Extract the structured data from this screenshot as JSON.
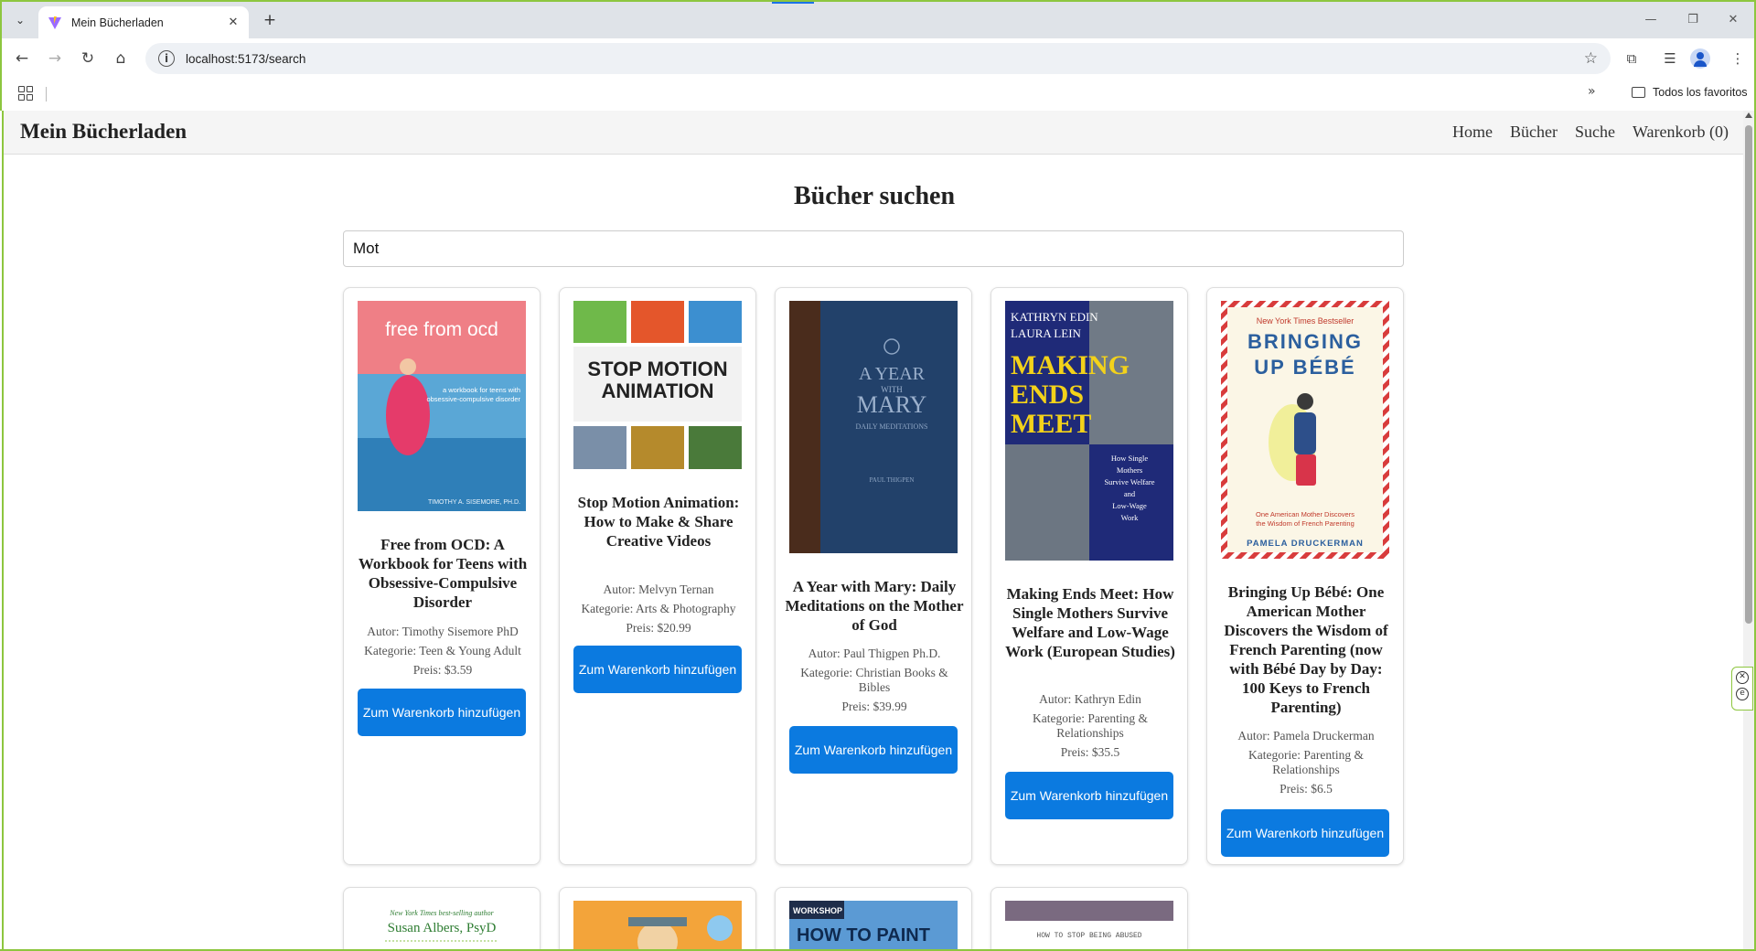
{
  "browser": {
    "tab_title": "Mein Bücherladen",
    "url": "localhost:5173/search",
    "bookmarks_all": "Todos los favoritos"
  },
  "site": {
    "brand": "Mein Bücherladen",
    "nav": [
      "Home",
      "Bücher",
      "Suche",
      "Warenkorb (0)"
    ]
  },
  "search": {
    "heading": "Bücher suchen",
    "query": "Mot"
  },
  "labels": {
    "author_prefix": "Autor:",
    "category_prefix": "Kategorie:",
    "price_prefix": "Preis:",
    "add_to_cart": "Zum Warenkorb hinzufügen"
  },
  "books": [
    {
      "title": "Free from OCD: A Workbook for Teens with Obsessive-Compulsive Disorder",
      "author": "Autor: Timothy Sisemore PhD",
      "category": "Kategorie: Teen & Young Adult",
      "price": "Preis: $3.59",
      "cover_text": [
        "free from ocd",
        "a workbook for teens with obsessive-compulsive disorder",
        "TIMOTHY A. SISEMORE, PH.D."
      ]
    },
    {
      "title": "Stop Motion Animation: How to Make & Share Creative Videos",
      "author": "Autor: Melvyn Ternan",
      "category": "Kategorie: Arts & Photography",
      "price": "Preis: $20.99",
      "cover_text": [
        "STOP MOTION",
        "ANIMATION"
      ]
    },
    {
      "title": "A Year with Mary: Daily Meditations on the Mother of God",
      "author": "Autor: Paul Thigpen Ph.D.",
      "category": "Kategorie: Christian Books & Bibles",
      "price": "Preis: $39.99",
      "cover_text": [
        "A YEAR",
        "WITH",
        "MARY",
        "DAILY MEDITATIONS",
        "ON THE",
        "MOTHER OF GOD",
        "PAUL THIGPEN"
      ]
    },
    {
      "title": "Making Ends Meet: How Single Mothers Survive Welfare and Low-Wage Work (European Studies)",
      "author": "Autor: Kathryn Edin",
      "category": "Kategorie: Parenting & Relationships",
      "price": "Preis: $35.5",
      "cover_text": [
        "KATHRYN EDIN",
        "LAURA LEIN",
        "MAKING",
        "ENDS",
        "MEET",
        "How Single Mothers Survive Welfare and Low-Wage Work"
      ]
    },
    {
      "title": "Bringing Up Bébé: One American Mother Discovers the Wisdom of French Parenting (now with Bébé Day by Day: 100 Keys to French Parenting)",
      "author": "Autor: Pamela Druckerman",
      "category": "Kategorie: Parenting & Relationships",
      "price": "Preis: $6.5",
      "cover_text": [
        "New York Times Bestseller",
        "BRINGING",
        "UP BÉBÉ",
        "One American Mother Discovers the Wisdom of French Parenting",
        "PAMELA DRUCKERMAN"
      ]
    }
  ],
  "partial_covers": [
    [
      "New York Times best-selling author",
      "Susan Albers, PsyD"
    ],
    [],
    [
      "WORKSHOP",
      "HOW TO PAINT"
    ],
    [
      "HOW TO STOP BEING ABUSED"
    ]
  ]
}
